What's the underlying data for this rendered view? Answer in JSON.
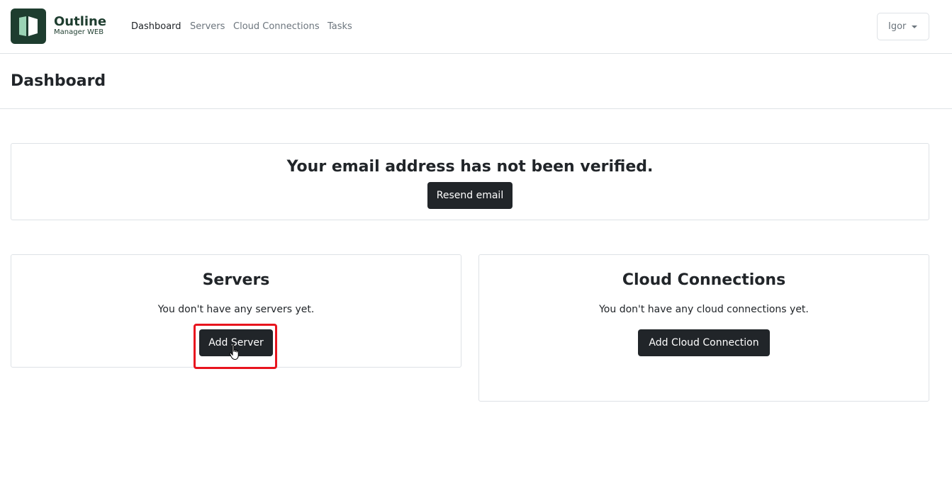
{
  "brand": {
    "title": "Outline",
    "subtitle": "Manager WEB"
  },
  "nav": {
    "items": [
      {
        "label": "Dashboard",
        "active": true
      },
      {
        "label": "Servers",
        "active": false
      },
      {
        "label": "Cloud Connections",
        "active": false
      },
      {
        "label": "Tasks",
        "active": false
      }
    ]
  },
  "user_menu": {
    "label": "Igor"
  },
  "page": {
    "title": "Dashboard"
  },
  "email_notice": {
    "message": "Your email address has not been verified.",
    "button_label": "Resend email"
  },
  "servers_card": {
    "title": "Servers",
    "empty_text": "You don't have any servers yet.",
    "button_label": "Add Server"
  },
  "cloud_card": {
    "title": "Cloud Connections",
    "empty_text": "You don't have any cloud connections yet.",
    "button_label": "Add Cloud Connection"
  },
  "colors": {
    "brand_dark_green": "#1e3d2f",
    "brand_light_green": "#9bd3b5",
    "button_dark": "#212529",
    "highlight_red": "#e8141e"
  },
  "icons": [
    "outline-logo-icon",
    "caret-down-icon",
    "hand-pointer-cursor-icon"
  ]
}
